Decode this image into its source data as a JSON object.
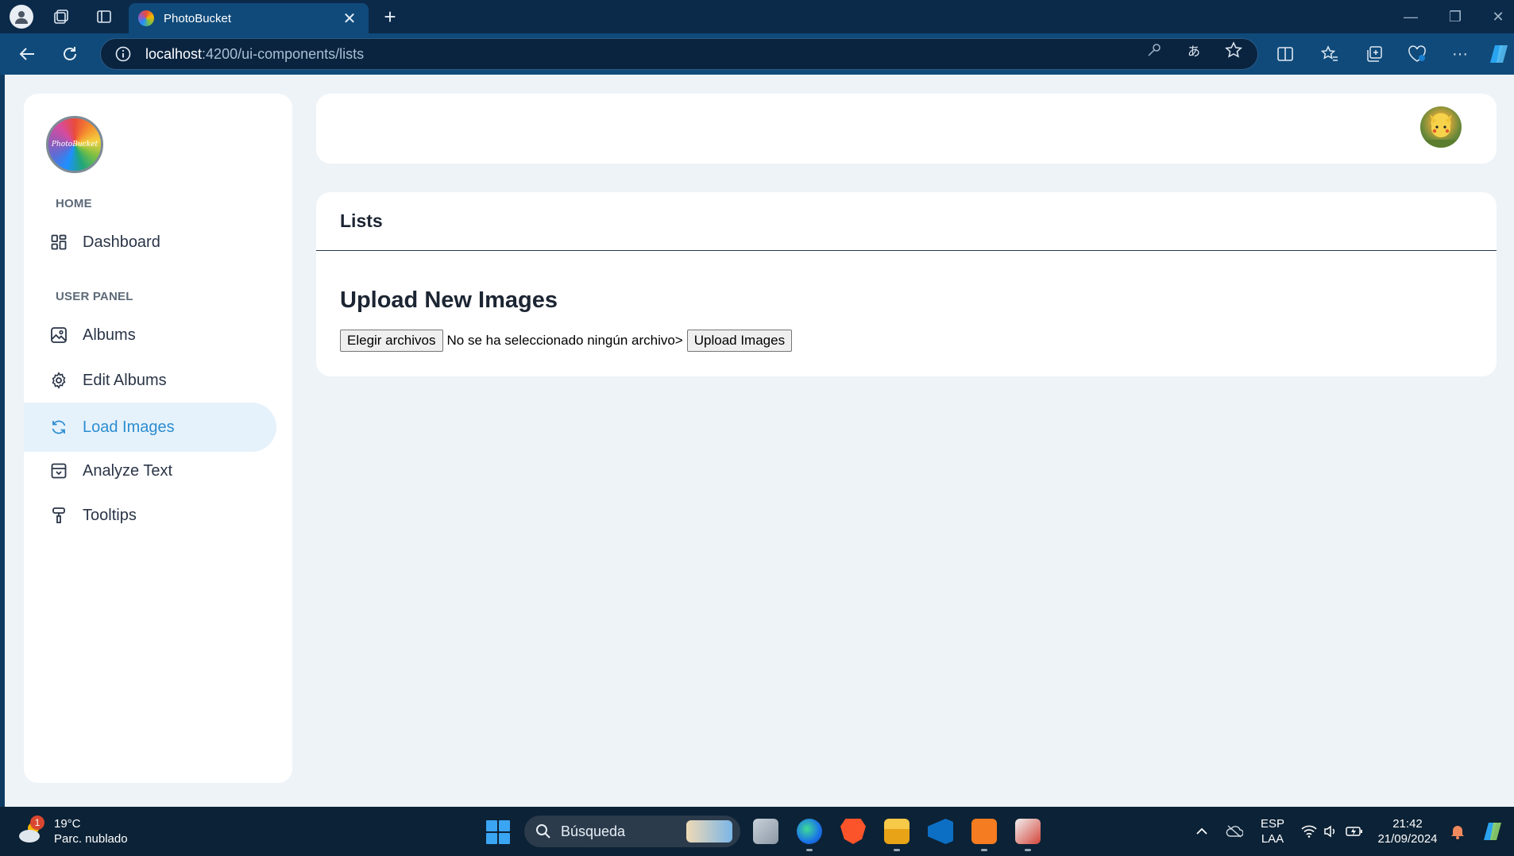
{
  "browser": {
    "tab_title": "PhotoBucket",
    "url_host": "localhost",
    "url_path": ":4200/ui-components/lists"
  },
  "sidebar": {
    "logo_text": "PhotoBucket",
    "section_home": "HOME",
    "section_user_panel": "USER PANEL",
    "items": [
      {
        "label": "Dashboard",
        "icon": "dashboard-icon"
      },
      {
        "label": "Albums",
        "icon": "image-icon"
      },
      {
        "label": "Edit Albums",
        "icon": "gear-icon"
      },
      {
        "label": "Load Images",
        "icon": "refresh-icon",
        "active": true
      },
      {
        "label": "Analyze Text",
        "icon": "archive-icon"
      },
      {
        "label": "Tooltips",
        "icon": "paint-roller-icon"
      }
    ]
  },
  "main": {
    "card_title": "Lists",
    "upload_title": "Upload New Images",
    "choose_files_label": "Elegir archivos",
    "file_status": "No se ha seleccionado ningún archivo>",
    "upload_button_label": "Upload Images"
  },
  "taskbar": {
    "temperature": "19°C",
    "weather_desc": "Parc. nublado",
    "weather_badge": "1",
    "search_placeholder": "Búsqueda",
    "lang_top": "ESP",
    "lang_bottom": "LAA",
    "time": "21:42",
    "date": "21/09/2024"
  },
  "colors": {
    "accent": "#2c8dd0",
    "active_bg": "#e6f2fb",
    "page_bg": "#eef3f8",
    "browser_frame": "#0f4a7a"
  }
}
